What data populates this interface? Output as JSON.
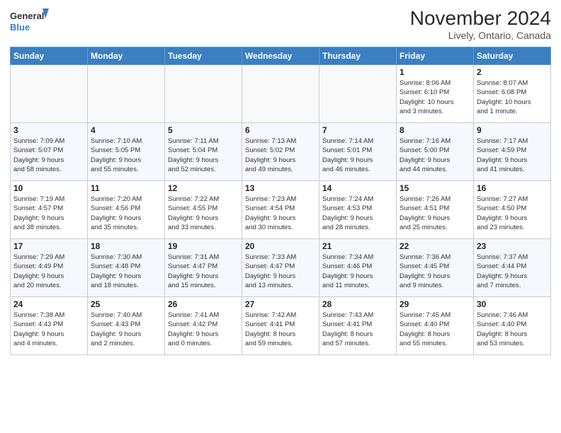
{
  "header": {
    "logo_line1": "General",
    "logo_line2": "Blue",
    "month_title": "November 2024",
    "location": "Lively, Ontario, Canada"
  },
  "weekdays": [
    "Sunday",
    "Monday",
    "Tuesday",
    "Wednesday",
    "Thursday",
    "Friday",
    "Saturday"
  ],
  "weeks": [
    [
      {
        "day": "",
        "info": ""
      },
      {
        "day": "",
        "info": ""
      },
      {
        "day": "",
        "info": ""
      },
      {
        "day": "",
        "info": ""
      },
      {
        "day": "",
        "info": ""
      },
      {
        "day": "1",
        "info": "Sunrise: 8:06 AM\nSunset: 6:10 PM\nDaylight: 10 hours\nand 3 minutes."
      },
      {
        "day": "2",
        "info": "Sunrise: 8:07 AM\nSunset: 6:08 PM\nDaylight: 10 hours\nand 1 minute."
      }
    ],
    [
      {
        "day": "3",
        "info": "Sunrise: 7:09 AM\nSunset: 5:07 PM\nDaylight: 9 hours\nand 58 minutes."
      },
      {
        "day": "4",
        "info": "Sunrise: 7:10 AM\nSunset: 5:05 PM\nDaylight: 9 hours\nand 55 minutes."
      },
      {
        "day": "5",
        "info": "Sunrise: 7:11 AM\nSunset: 5:04 PM\nDaylight: 9 hours\nand 52 minutes."
      },
      {
        "day": "6",
        "info": "Sunrise: 7:13 AM\nSunset: 5:02 PM\nDaylight: 9 hours\nand 49 minutes."
      },
      {
        "day": "7",
        "info": "Sunrise: 7:14 AM\nSunset: 5:01 PM\nDaylight: 9 hours\nand 46 minutes."
      },
      {
        "day": "8",
        "info": "Sunrise: 7:16 AM\nSunset: 5:00 PM\nDaylight: 9 hours\nand 44 minutes."
      },
      {
        "day": "9",
        "info": "Sunrise: 7:17 AM\nSunset: 4:59 PM\nDaylight: 9 hours\nand 41 minutes."
      }
    ],
    [
      {
        "day": "10",
        "info": "Sunrise: 7:19 AM\nSunset: 4:57 PM\nDaylight: 9 hours\nand 38 minutes."
      },
      {
        "day": "11",
        "info": "Sunrise: 7:20 AM\nSunset: 4:56 PM\nDaylight: 9 hours\nand 35 minutes."
      },
      {
        "day": "12",
        "info": "Sunrise: 7:22 AM\nSunset: 4:55 PM\nDaylight: 9 hours\nand 33 minutes."
      },
      {
        "day": "13",
        "info": "Sunrise: 7:23 AM\nSunset: 4:54 PM\nDaylight: 9 hours\nand 30 minutes."
      },
      {
        "day": "14",
        "info": "Sunrise: 7:24 AM\nSunset: 4:53 PM\nDaylight: 9 hours\nand 28 minutes."
      },
      {
        "day": "15",
        "info": "Sunrise: 7:26 AM\nSunset: 4:51 PM\nDaylight: 9 hours\nand 25 minutes."
      },
      {
        "day": "16",
        "info": "Sunrise: 7:27 AM\nSunset: 4:50 PM\nDaylight: 9 hours\nand 23 minutes."
      }
    ],
    [
      {
        "day": "17",
        "info": "Sunrise: 7:29 AM\nSunset: 4:49 PM\nDaylight: 9 hours\nand 20 minutes."
      },
      {
        "day": "18",
        "info": "Sunrise: 7:30 AM\nSunset: 4:48 PM\nDaylight: 9 hours\nand 18 minutes."
      },
      {
        "day": "19",
        "info": "Sunrise: 7:31 AM\nSunset: 4:47 PM\nDaylight: 9 hours\nand 15 minutes."
      },
      {
        "day": "20",
        "info": "Sunrise: 7:33 AM\nSunset: 4:47 PM\nDaylight: 9 hours\nand 13 minutes."
      },
      {
        "day": "21",
        "info": "Sunrise: 7:34 AM\nSunset: 4:46 PM\nDaylight: 9 hours\nand 11 minutes."
      },
      {
        "day": "22",
        "info": "Sunrise: 7:36 AM\nSunset: 4:45 PM\nDaylight: 9 hours\nand 9 minutes."
      },
      {
        "day": "23",
        "info": "Sunrise: 7:37 AM\nSunset: 4:44 PM\nDaylight: 9 hours\nand 7 minutes."
      }
    ],
    [
      {
        "day": "24",
        "info": "Sunrise: 7:38 AM\nSunset: 4:43 PM\nDaylight: 9 hours\nand 4 minutes."
      },
      {
        "day": "25",
        "info": "Sunrise: 7:40 AM\nSunset: 4:43 PM\nDaylight: 9 hours\nand 2 minutes."
      },
      {
        "day": "26",
        "info": "Sunrise: 7:41 AM\nSunset: 4:42 PM\nDaylight: 9 hours\nand 0 minutes."
      },
      {
        "day": "27",
        "info": "Sunrise: 7:42 AM\nSunset: 4:41 PM\nDaylight: 8 hours\nand 59 minutes."
      },
      {
        "day": "28",
        "info": "Sunrise: 7:43 AM\nSunset: 4:41 PM\nDaylight: 8 hours\nand 57 minutes."
      },
      {
        "day": "29",
        "info": "Sunrise: 7:45 AM\nSunset: 4:40 PM\nDaylight: 8 hours\nand 55 minutes."
      },
      {
        "day": "30",
        "info": "Sunrise: 7:46 AM\nSunset: 4:40 PM\nDaylight: 8 hours\nand 53 minutes."
      }
    ]
  ]
}
